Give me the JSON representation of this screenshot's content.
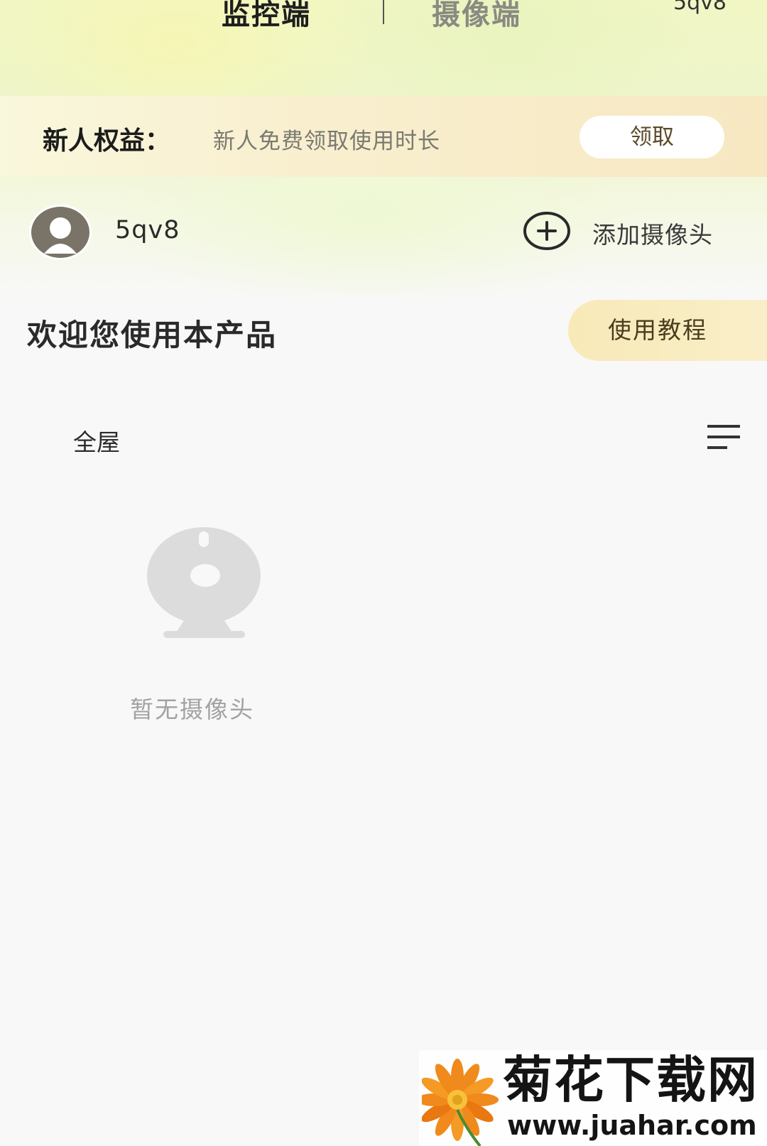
{
  "header": {
    "tabs": [
      {
        "label": "监控端",
        "active": true
      },
      {
        "label": "摄像端",
        "active": false
      }
    ],
    "account_id": "5qv8"
  },
  "benefit": {
    "title": "新人权益：",
    "description": "新人免费领取使用时长",
    "button_label": "领取"
  },
  "user": {
    "name": "5qv8",
    "avatar_icon": "default-avatar-icon",
    "add_camera_label": "添加摄像头",
    "add_icon": "plus-circle-icon"
  },
  "welcome": {
    "title": "欢迎您使用本产品",
    "tutorial_label": "使用教程"
  },
  "devices": {
    "room_filter": "全屋",
    "sort_icon": "menu-lines-icon",
    "empty_icon": "camera-placeholder-icon",
    "empty_text": "暂无摄像头"
  },
  "watermark": {
    "title": "菊花下载网",
    "url": "www.juahar.com"
  },
  "colors": {
    "accent_yellow": "#f8e9b8",
    "banner_bg": "#f9efcf",
    "text_dark": "#1e1e1e",
    "text_muted": "#8a8a82",
    "placeholder_gray": "#dcdcdc"
  }
}
